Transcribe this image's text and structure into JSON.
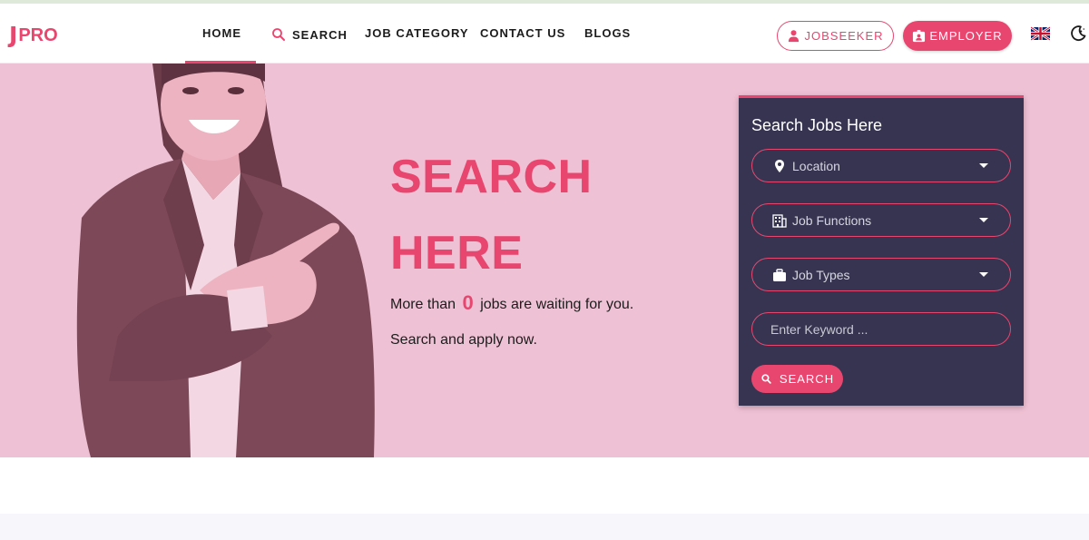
{
  "brand": {
    "logo_j": "J",
    "logo_pro": "PRO"
  },
  "nav": {
    "home": "HOME",
    "search": "SEARCH",
    "job_category": "JOB CATEGORY",
    "contact_us": "CONTACT US",
    "blogs": "BLOGS"
  },
  "header_actions": {
    "jobseeker_label": "JOBSEEKER",
    "employer_label": "EMPLOYER",
    "language_icon": "uk-flag-icon",
    "theme_icon": "moon-icon"
  },
  "hero": {
    "title_line1": "SEARCH",
    "title_line2": "HERE",
    "sub_prefix": "More than",
    "job_count": "0",
    "sub_suffix": "jobs are waiting for you.",
    "sub2": "Search and apply now."
  },
  "search_panel": {
    "title": "Search Jobs Here",
    "location_label": "Location",
    "job_functions_label": "Job Functions",
    "job_types_label": "Job Types",
    "keyword_placeholder": "Enter Keyword ...",
    "search_button": "SEARCH"
  },
  "colors": {
    "accent": "#e8466f",
    "hero_bg": "#efc1d4",
    "panel_bg": "#363450"
  }
}
